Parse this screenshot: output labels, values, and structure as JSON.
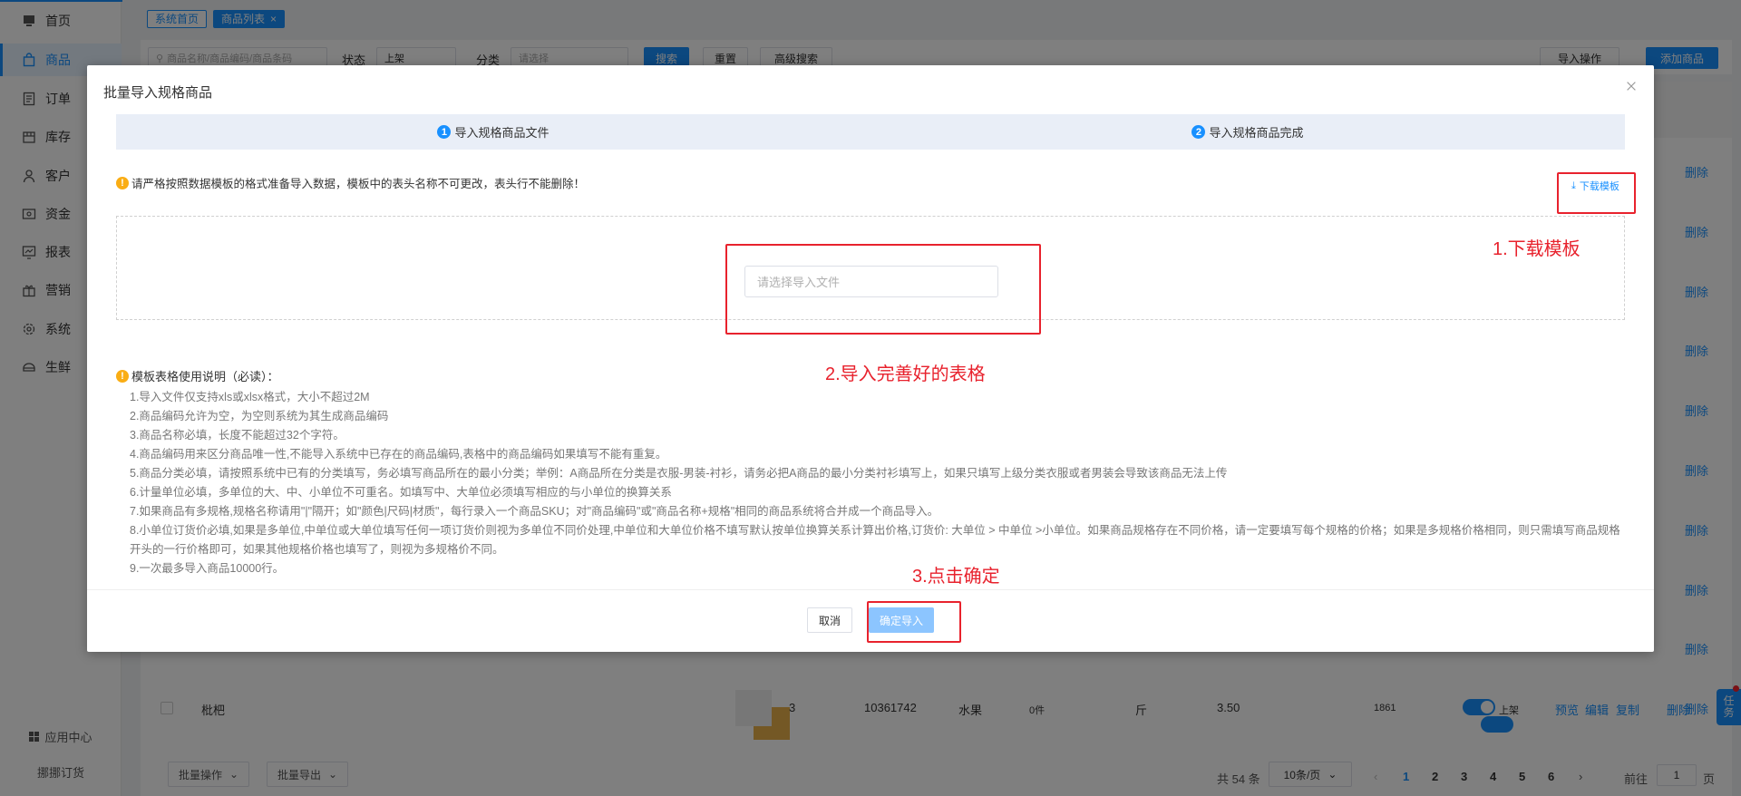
{
  "sidebar": {
    "items": [
      {
        "label": "首页",
        "icon": "monitor-icon"
      },
      {
        "label": "商品",
        "icon": "bag-icon"
      },
      {
        "label": "订单",
        "icon": "list-icon"
      },
      {
        "label": "库存",
        "icon": "box-icon"
      },
      {
        "label": "客户",
        "icon": "user-icon"
      },
      {
        "label": "资金",
        "icon": "wallet-icon"
      },
      {
        "label": "报表",
        "icon": "chart-icon"
      },
      {
        "label": "营销",
        "icon": "gift-icon"
      },
      {
        "label": "系统",
        "icon": "gear-icon"
      },
      {
        "label": "生鲜",
        "icon": "fresh-icon"
      }
    ],
    "app_center": "应用中心",
    "order": "挪挪订货"
  },
  "tabs": {
    "home": "系统首页",
    "product_list": "商品列表"
  },
  "filter": {
    "search_placeholder": "商品名称/商品编码/商品条码",
    "status_label": "状态",
    "status_value": "上架",
    "category_label": "分类",
    "category_placeholder": "请选择",
    "search_btn": "搜索",
    "reset_btn": "重置",
    "advanced_btn": "高级搜索",
    "import_btn": "导入操作",
    "add_btn": "添加商品"
  },
  "table": {
    "delete_label": "删除",
    "last_row": {
      "name": "枇杷",
      "sort": "3",
      "code": "10361742",
      "category": "水果",
      "stock": "0件",
      "unit": "斤",
      "price": "3.50",
      "sales": "1861",
      "status": "上架",
      "preview": "预览",
      "edit": "编辑",
      "copy": "复制",
      "delete": "删除"
    }
  },
  "bottom": {
    "batch_ops": "批量操作",
    "batch_export": "批量导出",
    "total": "共 54 条",
    "page_size": "10条/页",
    "pages": [
      "1",
      "2",
      "3",
      "4",
      "5",
      "6"
    ],
    "goto_label": "前往",
    "goto_value": "1",
    "page_unit": "页"
  },
  "task": {
    "label1": "任",
    "label2": "务"
  },
  "modal": {
    "title": "批量导入规格商品",
    "step1_num": "1",
    "step1": "导入规格商品文件",
    "step2_num": "2",
    "step2": "导入规格商品完成",
    "notice": "请严格按照数据模板的格式准备导入数据，模板中的表头名称不可更改，表头行不能删除！",
    "download": "下载模板",
    "file_placeholder": "请选择导入文件",
    "help_title": "模板表格使用说明（必读）：",
    "help": [
      "1.导入文件仅支持xls或xlsx格式，大小不超过2M",
      "2.商品编码允许为空，为空则系统为其生成商品编码",
      "3.商品名称必填，长度不能超过32个字符。",
      "4.商品编码用来区分商品唯一性,不能导入系统中已存在的商品编码,表格中的商品编码如果填写不能有重复。",
      "5.商品分类必填，请按照系统中已有的分类填写，务必填写商品所在的最小分类；举例：A商品所在分类是衣服-男装-衬衫，请务必把A商品的最小分类衬衫填写上，如果只填写上级分类衣服或者男装会导致该商品无法上传",
      "6.计量单位必填，多单位的大、中、小单位不可重名。如填写中、大单位必须填写相应的与小单位的换算关系",
      "7.如果商品有多规格,规格名称请用\"|\"隔开；如\"颜色|尺码|材质\"，每行录入一个商品SKU；对\"商品编码\"或\"商品名称+规格\"相同的商品系统将合并成一个商品导入。",
      "8.小单位订货价必填,如果是多单位,中单位或大单位填写任何一项订货价则视为多单位不同价处理,中单位和大单位价格不填写默认按单位换算关系计算出价格,订货价: 大单位 > 中单位 >小单位。如果商品规格存在不同价格，请一定要填写每个规格的价格；如果是多规格价格相同，则只需填写商品规格开头的一行价格即可，如果其他规格价格也填写了，则视为多规格价不同。",
      "9.一次最多导入商品10000行。"
    ],
    "cancel": "取消",
    "confirm": "确定导入"
  },
  "annotations": {
    "a1": "1.下载模板",
    "a2": "2.导入完善好的表格",
    "a3": "3.点击确定"
  },
  "colors": {
    "accent": "#1890ff",
    "annotation": "#e8222d",
    "warning": "#faad14"
  }
}
